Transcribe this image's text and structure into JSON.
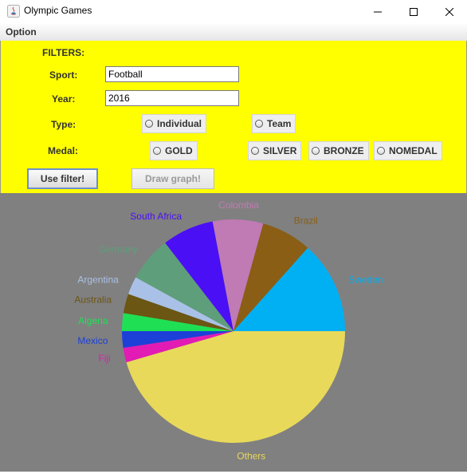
{
  "window": {
    "title": "Olympic Games"
  },
  "menu": {
    "items": [
      "Option"
    ]
  },
  "filters": {
    "heading": "FILTERS:",
    "sport_label": "Sport:",
    "sport_value": "Football",
    "year_label": "Year:",
    "year_value": "2016",
    "type_label": "Type:",
    "type_options": [
      "Individual",
      "Team"
    ],
    "medal_label": "Medal:",
    "medal_options": [
      "GOLD",
      "SILVER",
      "BRONZE",
      "NOMEDAL"
    ],
    "use_filter_label": "Use filter!",
    "draw_graph_label": "Draw graph!"
  },
  "chart_data": {
    "type": "pie",
    "start_angle_deg": 0,
    "direction": "clockwise",
    "slices": [
      {
        "label": "Others",
        "value": 45.5,
        "color": "#e8d95a"
      },
      {
        "label": "Fiji",
        "value": 2.1,
        "color": "#e21bb5"
      },
      {
        "label": "Mexico",
        "value": 2.4,
        "color": "#1c40d8"
      },
      {
        "label": "Algeria",
        "value": 2.6,
        "color": "#1fe055"
      },
      {
        "label": "Australia",
        "value": 2.8,
        "color": "#6b5614"
      },
      {
        "label": "Argentina",
        "value": 2.6,
        "color": "#a9c1e6"
      },
      {
        "label": "Germany",
        "value": 6.5,
        "color": "#5e9e7b"
      },
      {
        "label": "South Africa",
        "value": 7.5,
        "color": "#4a0ff5"
      },
      {
        "label": "Colombia",
        "value": 7.3,
        "color": "#c07ab4"
      },
      {
        "label": "Brazil",
        "value": 7.3,
        "color": "#8a5e14"
      },
      {
        "label": "Sweden",
        "value": 13.4,
        "color": "#00b0f3"
      }
    ]
  },
  "colors": {
    "panel_bg": "#ffff00",
    "chart_bg": "#808080"
  }
}
